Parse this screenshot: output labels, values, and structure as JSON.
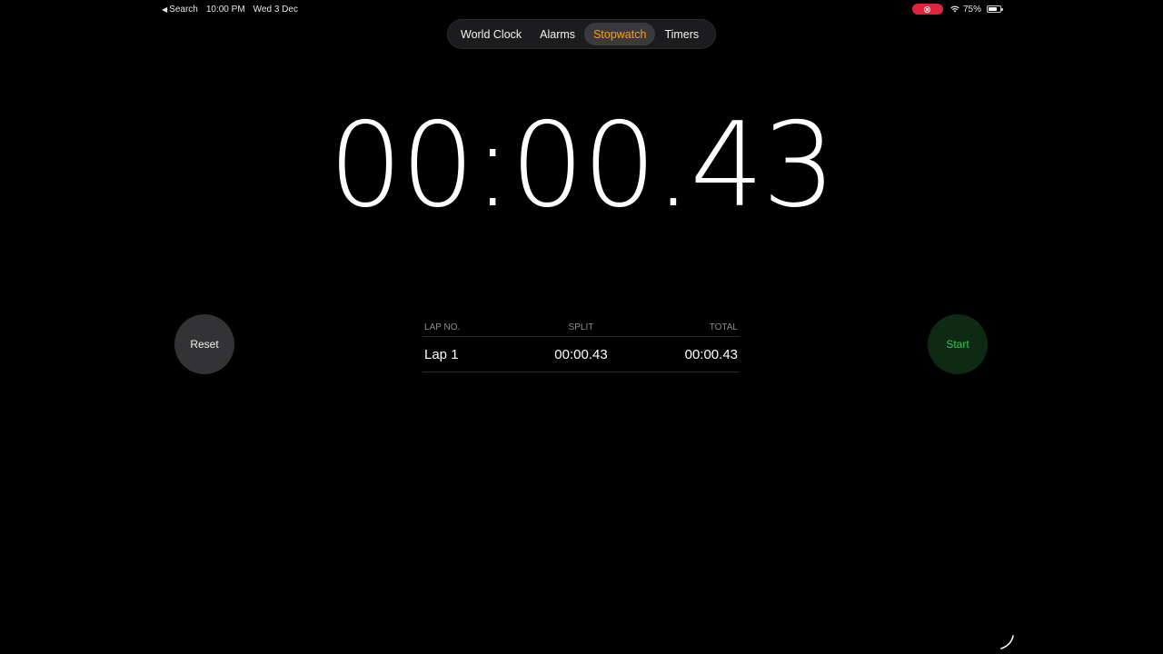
{
  "status_bar": {
    "back_label": "Search",
    "time": "10:00 PM",
    "date": "Wed 3 Dec",
    "battery": "75%",
    "battery_level": 0.75,
    "recording_color": "#e0243e"
  },
  "tabs": [
    {
      "label": "World Clock",
      "active": false
    },
    {
      "label": "Alarms",
      "active": false
    },
    {
      "label": "Stopwatch",
      "active": true
    },
    {
      "label": "Timers",
      "active": false
    }
  ],
  "accent_color": "#ff9f0a",
  "stopwatch": {
    "display": "00:00.43"
  },
  "buttons": {
    "reset_label": "Reset",
    "start_label": "Start",
    "start_color": "#34c759"
  },
  "laps": {
    "headers": {
      "lap": "LAP NO.",
      "split": "SPLIT",
      "total": "TOTAL"
    },
    "rows": [
      {
        "lap": "Lap 1",
        "split": "00:00.43",
        "total": "00:00.43"
      }
    ]
  },
  "icons": [
    "back-arrow-icon",
    "recording-icon",
    "wifi-icon",
    "battery-icon"
  ]
}
